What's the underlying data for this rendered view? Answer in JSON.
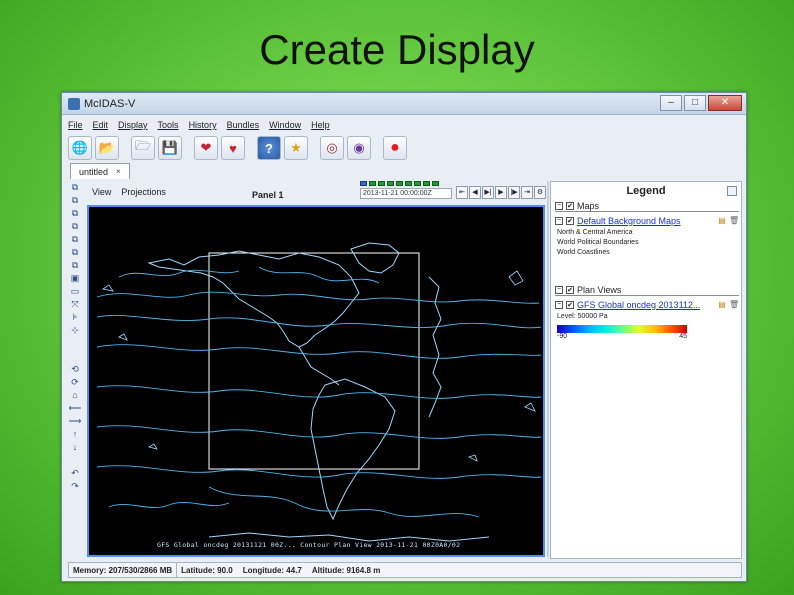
{
  "slide": {
    "title": "Create Display"
  },
  "window": {
    "title": "McIDAS-V",
    "controls": {
      "minimize": "–",
      "maximize": "□",
      "close": "✕"
    }
  },
  "menubar": [
    "File",
    "Edit",
    "Display",
    "Tools",
    "History",
    "Bundles",
    "Window",
    "Help"
  ],
  "toolbar": {
    "buttons": [
      {
        "icon": "globe-icon",
        "glyph": "🌐"
      },
      {
        "icon": "folder-icon",
        "glyph": "📂"
      },
      {
        "icon": "folder-open-icon",
        "glyph": "🗁"
      },
      {
        "icon": "save-icon",
        "glyph": "💾"
      },
      {
        "icon": "heart-icon",
        "glyph": "❤"
      },
      {
        "icon": "hearts-icon",
        "glyph": "♥"
      },
      {
        "icon": "help-icon",
        "glyph": "?"
      },
      {
        "icon": "favorite-folder-icon",
        "glyph": "★"
      },
      {
        "icon": "capture-icon",
        "glyph": "◎"
      },
      {
        "icon": "camera-icon",
        "glyph": "◉"
      },
      {
        "icon": "stop-icon",
        "glyph": "●"
      }
    ]
  },
  "tabs": [
    {
      "label": "untitled",
      "close": "×"
    }
  ],
  "left_tools": [
    "⧉",
    "⧉",
    "⧉",
    "⧉",
    "⧉",
    "⧉",
    "⧉",
    "▣",
    "▭",
    "⤧",
    "⊧",
    "⊹",
    "",
    "",
    "⟲",
    "⟳",
    "⌂",
    "⟵",
    "⟶",
    "↑",
    "↓",
    "",
    "↶",
    "↷"
  ],
  "view": {
    "view_menu": "View",
    "projections_menu": "Projections",
    "panel_label": "Panel 1",
    "animation": {
      "time": "2013-11-21 00:00:00Z",
      "steps": 9,
      "current_step": 0,
      "controls": [
        "⇤",
        "◀",
        "▶|",
        "▶",
        "|▶",
        "⇥",
        "⚙"
      ]
    },
    "footer": "GFS Global oncdeg 20131121 00Z...     Contour Plan View 2013-11-21 00Z0A0/02"
  },
  "legend": {
    "title": "Legend",
    "sections": [
      {
        "header": "Maps",
        "layer": "Default Background Maps",
        "items": [
          "North & Central America",
          "World Political Boundaries",
          "World Coastlines"
        ]
      },
      {
        "header": "Plan Views",
        "layer": "GFS Global oncdeg 2013112...",
        "level": "Level: 50000 Pa",
        "colorbar": {
          "min": "-90",
          "max": "45"
        }
      }
    ]
  },
  "status": {
    "memory": "Memory: 207/530/2866 MB",
    "latitude": "Latitude: 90.0",
    "longitude": "Longitude: 44.7",
    "altitude": "Altitude: 9164.8 m"
  },
  "colors": {
    "background_green": "#4db52c",
    "map_background": "#000000",
    "contour_color": "#4fb6f0",
    "coastline_color": "#9fd8ff",
    "view_border": "#4e8ff0"
  }
}
